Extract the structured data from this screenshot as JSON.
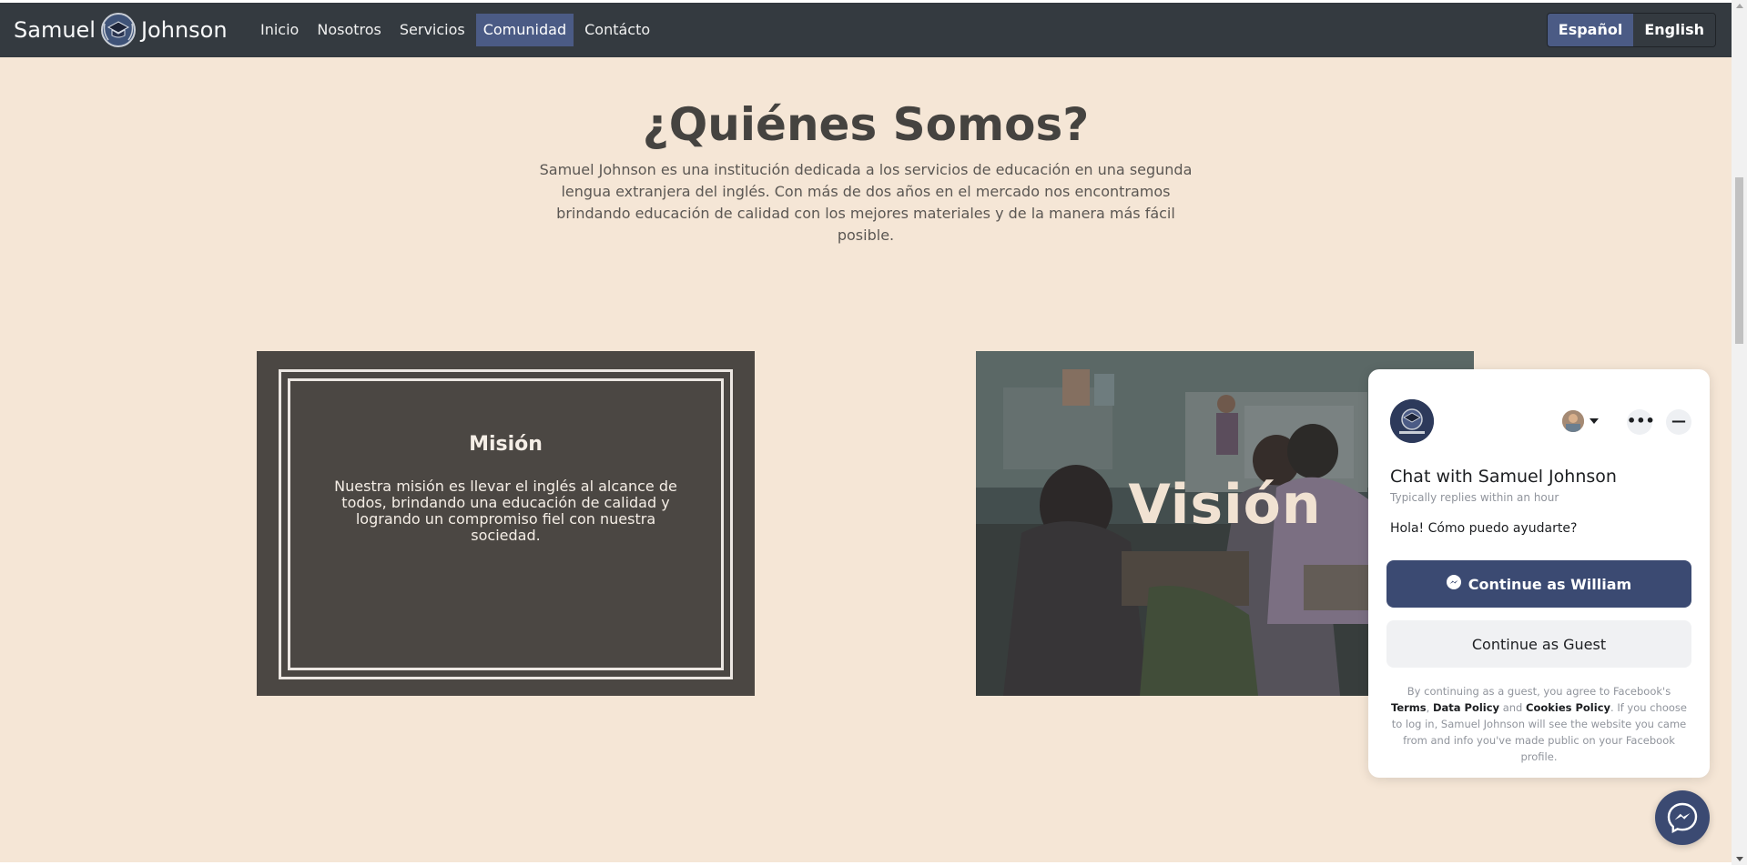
{
  "navbar": {
    "brand_left": "Samuel",
    "brand_right": "Johnson",
    "links": [
      "Inicio",
      "Nosotros",
      "Servicios",
      "Comunidad",
      "Contácto"
    ],
    "active_link": "Comunidad",
    "languages": [
      "Español",
      "English"
    ],
    "active_language": "Español"
  },
  "about": {
    "heading": "¿Quiénes Somos?",
    "intro": "Samuel Johnson es una institución dedicada a los servicios de educación en una segunda lengua extranjera del inglés. Con más de dos años en el mercado nos encontramos brindando educación de calidad con los mejores materiales y de la manera más fácil posible."
  },
  "mission": {
    "title": "Misión",
    "text": "Nuestra misión es llevar el inglés al alcance de todos, brindando una educación de calidad y logrando un compromiso fiel con nuestra sociedad."
  },
  "vision": {
    "title": "Visión"
  },
  "chat": {
    "title": "Chat with Samuel Johnson",
    "subtitle": "Typically replies within an hour",
    "message": "Hola! Cómo puedo ayudarte?",
    "continue_button": "Continue as William",
    "guest_button": "Continue as Guest",
    "legal_prefix": "By continuing as a guest, you agree to Facebook's",
    "terms": "Terms",
    "data_policy": "Data Policy",
    "legal_and": "and",
    "cookies_policy": "Cookies Policy",
    "legal_suffix": ". If you choose to log in, Samuel Johnson will see the website you came from and info you've made public on your Facebook profile.",
    "more_label": "•••",
    "minimize_label": "—"
  },
  "icons": {
    "logo": "graduation-cap-shield-icon",
    "messenger": "messenger-icon",
    "dropdown": "caret-down-icon"
  },
  "colors": {
    "navbar_bg": "#343a40",
    "accent": "#4b5b85",
    "page_bg": "#f5e6d6",
    "card_bg": "#4b4743",
    "chat_button": "#3b4a72"
  }
}
